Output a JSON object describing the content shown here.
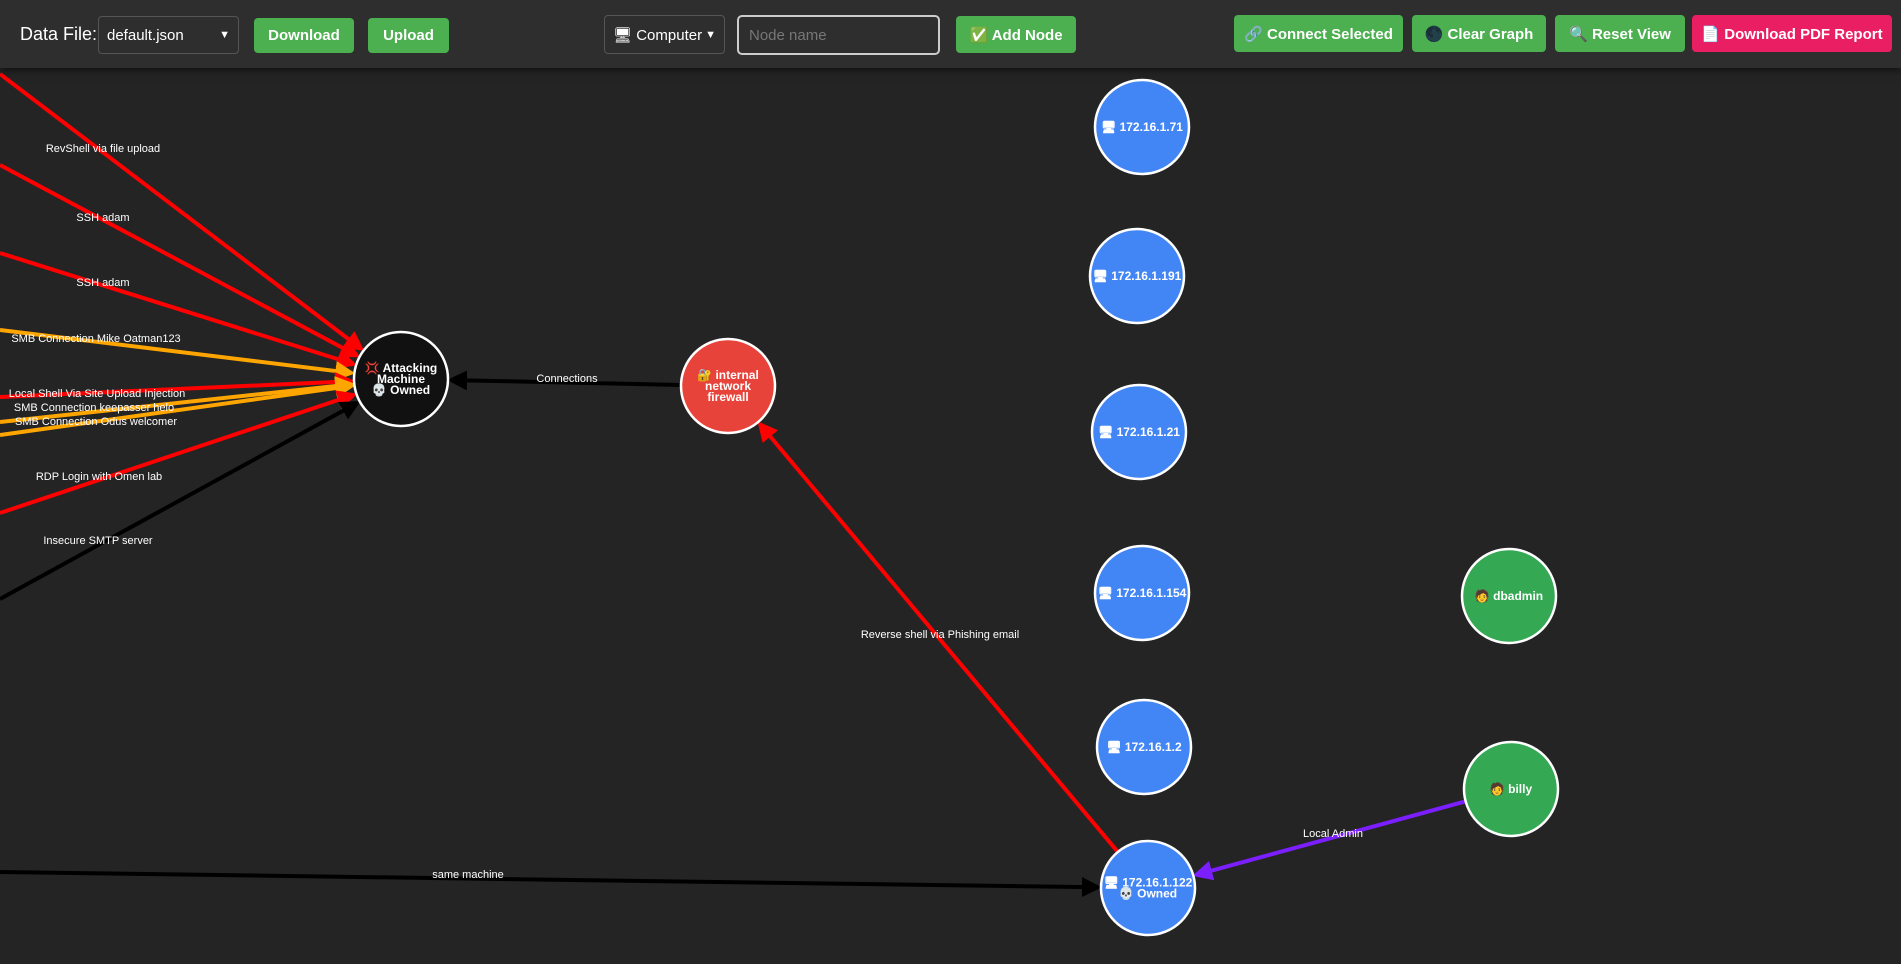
{
  "toolbar": {
    "data_file_label": "Data File:",
    "data_file_value": "default.json",
    "download_label": "Download",
    "upload_label": "Upload",
    "node_type_value": "🖥 Computer",
    "node_name_placeholder": "Node name",
    "add_node_label": "✅ Add Node",
    "connect_selected_label": "🔗 Connect Selected",
    "clear_graph_label": "🌑 Clear Graph",
    "reset_view_label": "🔍 Reset View",
    "download_pdf_label": "📄 Download PDF Report"
  },
  "colors": {
    "toolbar_bg": "#2e2e2e",
    "canvas_bg": "#242424",
    "button_green": "#4caf50",
    "button_pink": "#e91e63",
    "node_black": "#111111",
    "node_red": "#e8433a",
    "node_blue": "#4285f4",
    "node_green": "#34a853",
    "edge_red": "#ff0000",
    "edge_orange": "#ffa500",
    "edge_black": "#000000",
    "edge_purple": "#7b1fff"
  },
  "nodes": [
    {
      "id": "attacker",
      "lines": [
        "💢 Attacking",
        "Machine",
        "💀 Owned"
      ],
      "color": "#111111"
    },
    {
      "id": "firewall",
      "lines": [
        "🔐 internal",
        "network",
        "firewall"
      ],
      "color": "#e8433a"
    },
    {
      "id": "h71",
      "lines": [
        "🖥 172.16.1.71"
      ],
      "color": "#4285f4"
    },
    {
      "id": "h191",
      "lines": [
        "🖥 172.16.1.191"
      ],
      "color": "#4285f4"
    },
    {
      "id": "h21",
      "lines": [
        "🖥 172.16.1.21"
      ],
      "color": "#4285f4"
    },
    {
      "id": "h154",
      "lines": [
        "🖥 172.16.1.154"
      ],
      "color": "#4285f4"
    },
    {
      "id": "h2",
      "lines": [
        "🖥 172.16.1.2"
      ],
      "color": "#4285f4"
    },
    {
      "id": "h122",
      "lines": [
        "🖥 172.16.1.122",
        "💀 Owned"
      ],
      "color": "#4285f4"
    },
    {
      "id": "dbadmin",
      "lines": [
        "🧑 dbadmin"
      ],
      "color": "#34a853"
    },
    {
      "id": "billy",
      "lines": [
        "🧑 billy"
      ],
      "color": "#34a853"
    }
  ],
  "edges": [
    {
      "from": "offscreen-a",
      "to": "attacker",
      "label": "RevShell via file upload",
      "color": "#ff0000"
    },
    {
      "from": "offscreen-b",
      "to": "attacker",
      "label": "SSH adam",
      "color": "#ff0000"
    },
    {
      "from": "offscreen-c",
      "to": "attacker",
      "label": "SSH adam",
      "color": "#ff0000"
    },
    {
      "from": "offscreen-d",
      "to": "attacker",
      "label": "SMB Connection Mike Oatman123",
      "color": "#ffa500"
    },
    {
      "from": "offscreen-e",
      "to": "attacker",
      "label": "Local Shell Via Site Upload Injection",
      "color": "#ff0000"
    },
    {
      "from": "offscreen-f",
      "to": "attacker",
      "label": "SMB Connection keepasser helo",
      "color": "#ffa500"
    },
    {
      "from": "offscreen-g",
      "to": "attacker",
      "label": "SMB Connection Odus welcomer",
      "color": "#ffa500"
    },
    {
      "from": "offscreen-h",
      "to": "attacker",
      "label": "RDP Login with Omen lab",
      "color": "#ff0000"
    },
    {
      "from": "offscreen-i",
      "to": "attacker",
      "label": "Insecure SMTP server",
      "color": "#000000"
    },
    {
      "from": "firewall",
      "to": "attacker",
      "label": "Connections",
      "color": "#000000"
    },
    {
      "from": "h122",
      "to": "firewall",
      "label": "Reverse shell via Phishing email",
      "color": "#ff0000"
    },
    {
      "from": "billy",
      "to": "h122",
      "label": "Local Admin",
      "color": "#7b1fff"
    },
    {
      "from": "offscreen-j",
      "to": "h122",
      "label": "same machine",
      "color": "#000000"
    }
  ]
}
